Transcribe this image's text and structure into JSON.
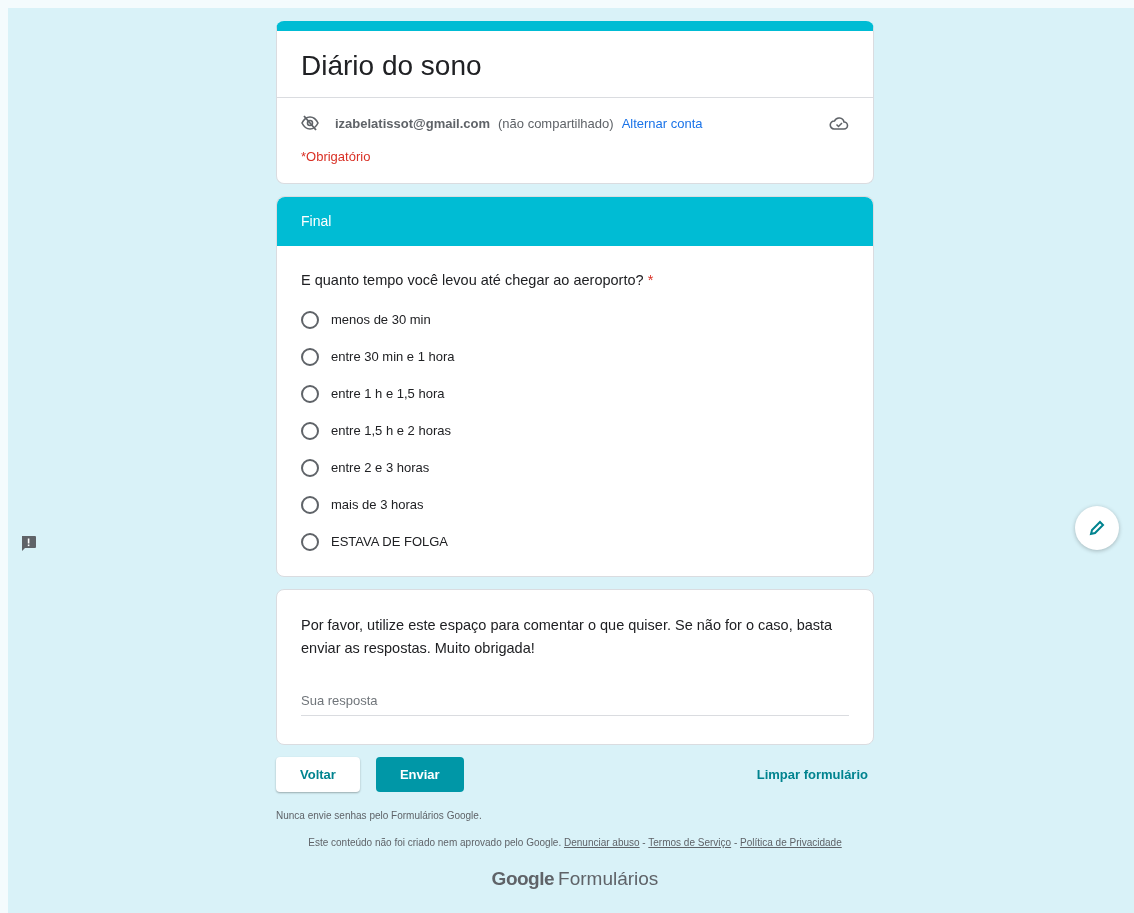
{
  "form": {
    "title": "Diário do sono",
    "account_email": "izabelatissot@gmail.com",
    "account_note": "(não compartilhado)",
    "switch_account": "Alternar conta",
    "required_note": "*Obrigatório"
  },
  "section": {
    "title": "Final"
  },
  "question": {
    "text": "E quanto tempo você levou até chegar ao aeroporto?",
    "required_mark": "*",
    "options": [
      {
        "label": "menos de 30 min",
        "selected": false
      },
      {
        "label": "entre 30 min e 1 hora",
        "selected": false
      },
      {
        "label": "entre 1 h e 1,5 hora",
        "selected": false
      },
      {
        "label": "entre 1,5 h e 2 horas",
        "selected": false
      },
      {
        "label": "entre 2 e 3 horas",
        "selected": false
      },
      {
        "label": "mais de 3 horas",
        "selected": false
      },
      {
        "label": "ESTAVA DE FOLGA",
        "selected": false
      }
    ]
  },
  "comment": {
    "text": "Por favor, utilize este espaço para comentar o que quiser. Se não for o caso, basta enviar as respostas. Muito obrigada!",
    "placeholder": "Sua resposta"
  },
  "buttons": {
    "back": "Voltar",
    "submit": "Enviar",
    "clear": "Limpar formulário"
  },
  "footer": {
    "warning": "Nunca envie senhas pelo Formulários Google.",
    "disclaimer": "Este conteúdo não foi criado nem aprovado pelo Google.",
    "links": [
      "Denunciar abuso",
      "Termos de Serviço",
      "Política de Privacidade"
    ],
    "separator": "-",
    "logo_brand": "Google",
    "logo_product": "Formulários"
  }
}
